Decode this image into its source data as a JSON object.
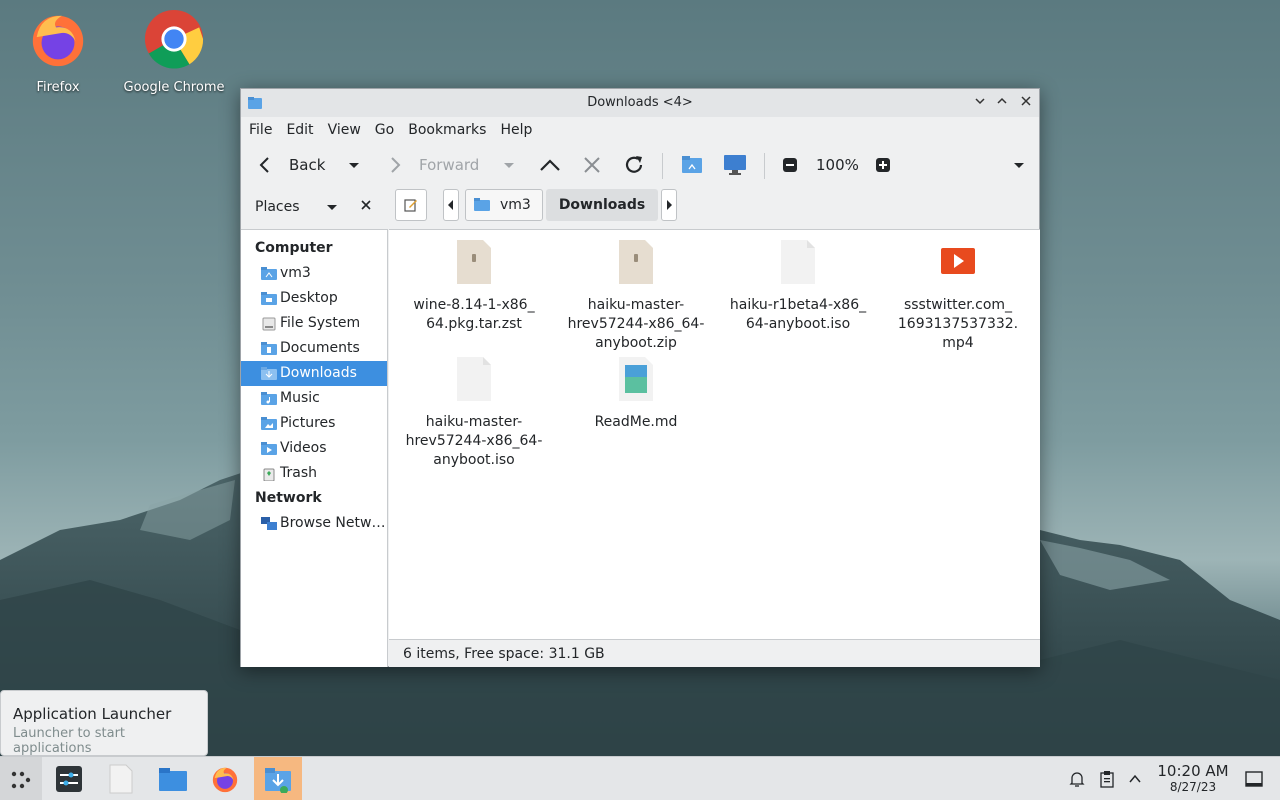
{
  "desktop": {
    "icons": [
      {
        "label": "Firefox",
        "icon": "firefox-icon"
      },
      {
        "label": "Google Chrome",
        "icon": "chrome-icon"
      }
    ]
  },
  "window": {
    "title": "Downloads <4>",
    "menu": [
      "File",
      "Edit",
      "View",
      "Go",
      "Bookmarks",
      "Help"
    ],
    "toolbar": {
      "back_label": "Back",
      "forward_label": "Forward",
      "zoom": "100%"
    },
    "places_label": "Places",
    "breadcrumb": [
      "vm3",
      "Downloads"
    ],
    "sidebar": {
      "computer_heading": "Computer",
      "computer_items": [
        {
          "label": "vm3",
          "icon": "home-folder-icon"
        },
        {
          "label": "Desktop",
          "icon": "desktop-folder-icon"
        },
        {
          "label": "File System",
          "icon": "drive-icon"
        },
        {
          "label": "Documents",
          "icon": "documents-folder-icon"
        },
        {
          "label": "Downloads",
          "icon": "downloads-folder-icon",
          "selected": true
        },
        {
          "label": "Music",
          "icon": "music-folder-icon"
        },
        {
          "label": "Pictures",
          "icon": "pictures-folder-icon"
        },
        {
          "label": "Videos",
          "icon": "videos-folder-icon"
        },
        {
          "label": "Trash",
          "icon": "trash-icon"
        }
      ],
      "network_heading": "Network",
      "network_items": [
        {
          "label": "Browse Netw…",
          "icon": "network-icon"
        }
      ]
    },
    "files": [
      {
        "lines": [
          "wine-8.14-1-x86_",
          "64.pkg.tar.zst"
        ],
        "icon": "archive-file-icon"
      },
      {
        "lines": [
          "haiku-master-",
          "hrev57244-x86_64-",
          "anyboot.zip"
        ],
        "icon": "zip-file-icon"
      },
      {
        "lines": [
          "haiku-r1beta4-x86_",
          "64-anyboot.iso"
        ],
        "icon": "blank-file-icon"
      },
      {
        "lines": [
          "ssstwitter.com_",
          "1693137537332.",
          "mp4"
        ],
        "icon": "video-file-icon"
      },
      {
        "lines": [
          "haiku-master-",
          "hrev57244-x86_64-",
          "anyboot.iso"
        ],
        "icon": "blank-file-icon"
      },
      {
        "lines": [
          "ReadMe.md"
        ],
        "icon": "markdown-file-icon"
      }
    ],
    "status": "6 items, Free space: 31.1 GB"
  },
  "tooltip": {
    "title": "Application Launcher",
    "subtitle": "Launcher to start applications"
  },
  "taskbar": {
    "time": "10:20 AM",
    "date": "8/27/23"
  },
  "colors": {
    "selection": "#3d8fe0",
    "folder_blue": "#5aa3e6"
  }
}
